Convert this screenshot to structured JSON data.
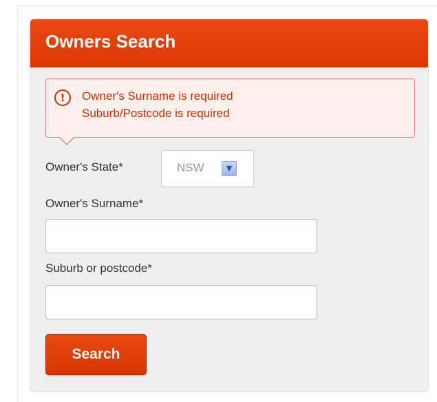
{
  "panel": {
    "title": "Owners Search"
  },
  "errors": {
    "icon": "alert-circle-icon",
    "messages": [
      "Owner's Surname is required",
      "Suburb/Postcode is required"
    ],
    "color": "#cc2f00"
  },
  "form": {
    "state_label": "Owner's State*",
    "state_value": "NSW",
    "surname_label": "Owner's Surname*",
    "surname_value": "",
    "suburb_label": "Suburb or postcode*",
    "suburb_value": "",
    "submit_label": "Search"
  },
  "colors": {
    "accent": "#dc3700",
    "panel_bg": "#efefef"
  }
}
